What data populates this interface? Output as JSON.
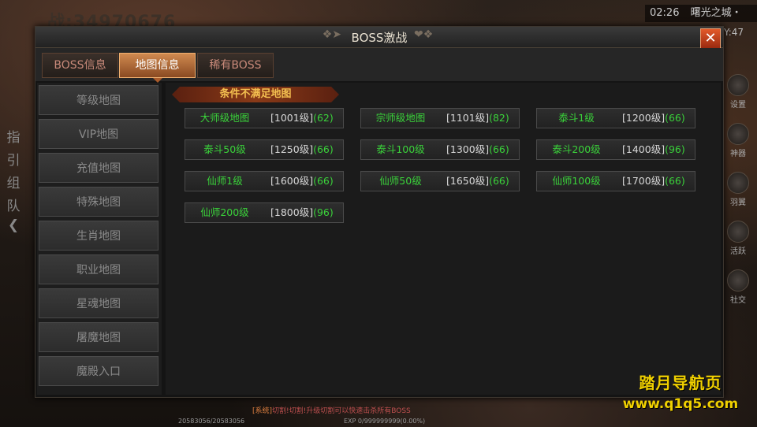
{
  "background": {
    "top_text": "战:34970676",
    "clock": {
      "time": "02:26",
      "location": "曙光之城・一"
    },
    "coord": "Y:47",
    "left_bar": [
      "指",
      "引",
      "组",
      "队"
    ],
    "right_bar": [
      "设置",
      "神器",
      "羽翼",
      "活跃",
      "社交"
    ],
    "chat_prefix": "[系统]",
    "chat_text": "切割!切割!升级切割可以快速击杀所有BOSS",
    "exp_text": "EXP 0/999999999(0.00%)",
    "hp_text": "20583056/20583056"
  },
  "dialog": {
    "title": "BOSS激战",
    "close_label": "✕",
    "tabs": [
      {
        "label": "BOSS信息",
        "active": false
      },
      {
        "label": "地图信息",
        "active": true
      },
      {
        "label": "稀有BOSS",
        "active": false
      }
    ],
    "side_menu": [
      "等级地图",
      "VIP地图",
      "充值地图",
      "特殊地图",
      "生肖地图",
      "职业地图",
      "星魂地图",
      "屠魔地图",
      "魔殿入口"
    ],
    "section_title": "条件不满足地图",
    "maps": [
      {
        "name": "大师级地图",
        "level": "[1001级]",
        "count": "(62)"
      },
      {
        "name": "宗师级地图",
        "level": "[1101级]",
        "count": "(82)"
      },
      {
        "name": "泰斗1级",
        "level": "[1200级]",
        "count": "(66)"
      },
      {
        "name": "泰斗50级",
        "level": "[1250级]",
        "count": "(66)"
      },
      {
        "name": "泰斗100级",
        "level": "[1300级]",
        "count": "(66)"
      },
      {
        "name": "泰斗200级",
        "level": "[1400级]",
        "count": "(96)"
      },
      {
        "name": "仙师1级",
        "level": "[1600级]",
        "count": "(66)"
      },
      {
        "name": "仙师50级",
        "level": "[1650级]",
        "count": "(66)"
      },
      {
        "name": "仙师100级",
        "level": "[1700级]",
        "count": "(66)"
      },
      {
        "name": "仙师200级",
        "level": "[1800级]",
        "count": "(96)"
      }
    ]
  },
  "watermark": {
    "line1": "踏月导航页",
    "line2": "www.q1q5.com"
  },
  "colors": {
    "accent": "#d08a50",
    "map_name": "#3ad23a",
    "banner_text": "#f4c050",
    "close": "#e25a2a"
  }
}
